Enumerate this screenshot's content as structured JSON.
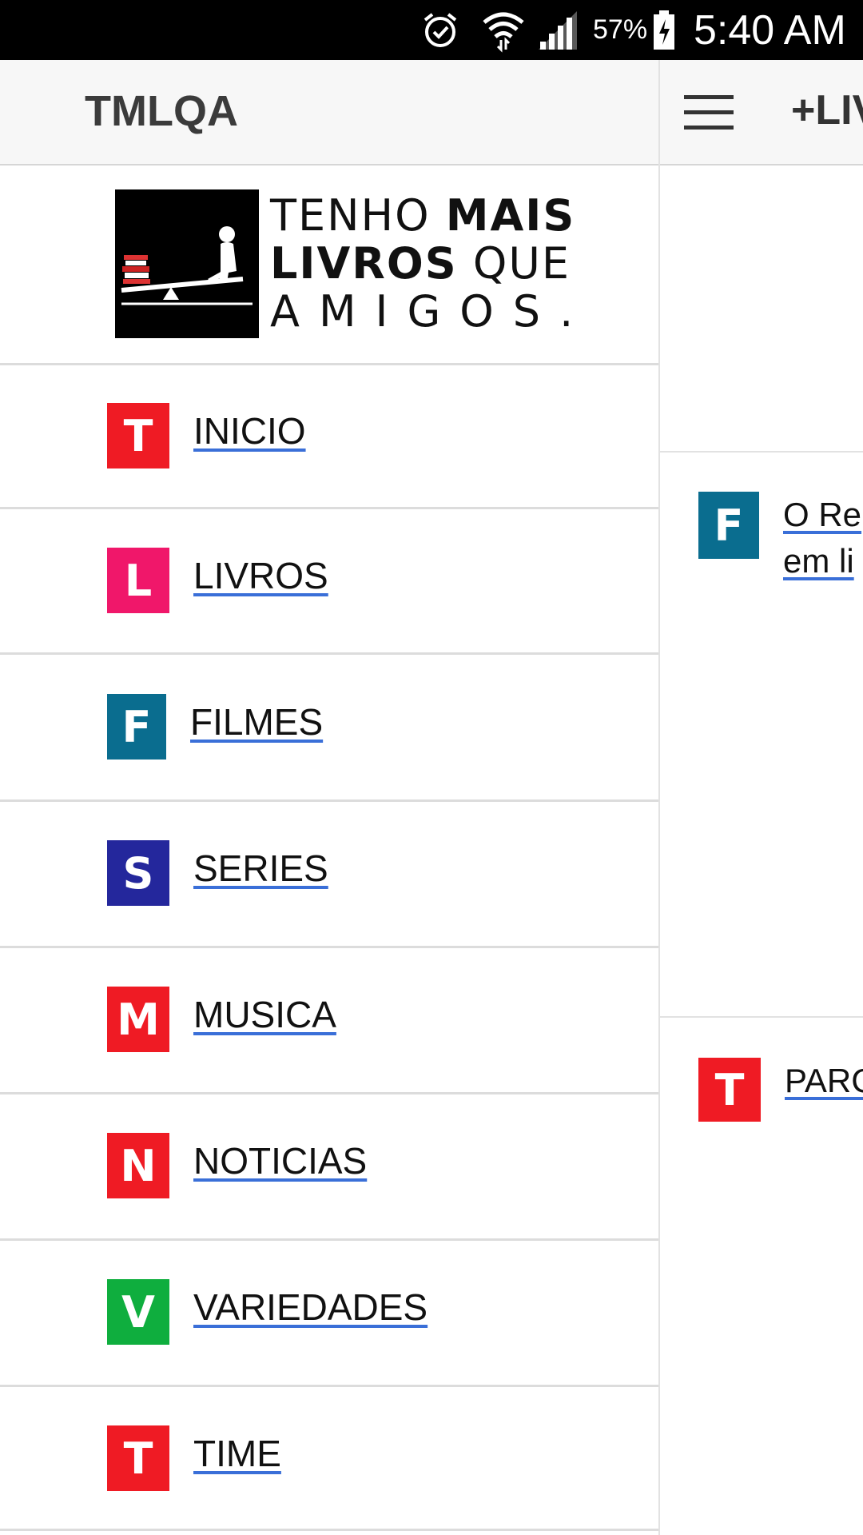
{
  "status_bar": {
    "battery_percent": "57%",
    "time": "5:40 AM",
    "icons": [
      "alarm-icon",
      "wifi-icon",
      "signal-icon",
      "battery-icon"
    ]
  },
  "drawer": {
    "title": "TMLQA",
    "logo": {
      "line1_a": "TENHO",
      "line1_b": "MAIS",
      "line2_a": "LIVROS",
      "line2_b": "QUE",
      "line3": "AMIGOS."
    },
    "items": [
      {
        "letter": "T",
        "label": "INICIO",
        "color": "#ef1b24"
      },
      {
        "letter": "L",
        "label": "LIVROS",
        "color": "#f0176a"
      },
      {
        "letter": "F",
        "label": "FILMES",
        "color": "#0a6d8f"
      },
      {
        "letter": "S",
        "label": "SERIES",
        "color": "#24279c"
      },
      {
        "letter": "M",
        "label": "MUSICA",
        "color": "#ef1b24"
      },
      {
        "letter": "N",
        "label": "NOTICIAS",
        "color": "#ef1b24"
      },
      {
        "letter": "V",
        "label": "VARIEDADES",
        "color": "#0fae3e"
      },
      {
        "letter": "T",
        "label": "TIME",
        "color": "#ef1b24"
      }
    ]
  },
  "main": {
    "title": "+LIV",
    "posts": [
      {
        "letter": "F",
        "line1": "O Re",
        "line2": "em li",
        "color": "#0a6d8f"
      },
      {
        "letter": "T",
        "line1": "PARC",
        "color": "#ef1b24"
      }
    ]
  }
}
